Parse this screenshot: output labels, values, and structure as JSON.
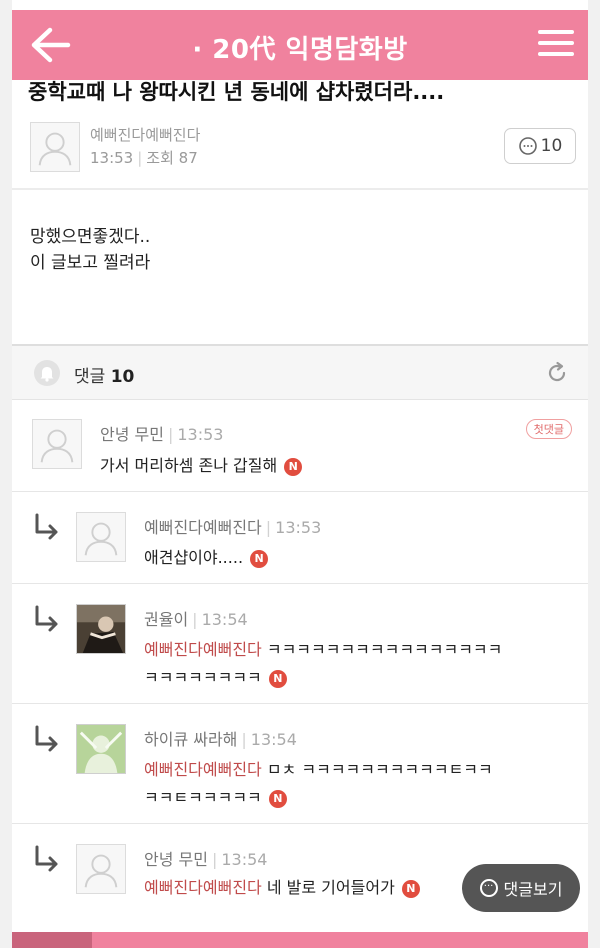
{
  "header": {
    "title": "· 20代 익명담화방"
  },
  "post": {
    "title": "중학교때 나 왕따시킨 년 동네에 샵차렸더라....",
    "author": "예뻐진다예뻐진다",
    "time": "13:53",
    "views": "조회 87",
    "comment_count": "10",
    "body_lines": [
      "망했으면좋겠다..",
      "이 글보고 찔려라"
    ]
  },
  "comments_bar": {
    "label": "댓글",
    "count": "10"
  },
  "comments": [
    {
      "name": "안녕 무민",
      "time": "13:53",
      "badge": "첫댓글",
      "text": "가서 머리하셈 존나 갑질해"
    },
    {
      "name": "예뻐진다예뻐진다",
      "time": "13:53",
      "text": "애견샵이야....."
    },
    {
      "name": "권율이",
      "time": "13:54",
      "mention": "예뻐진다예뻐진다",
      "text_line1": " ㅋㅋㅋㅋㅋㅋㅋㅋㅋㅋㅋㅋㅋㅋㅋㅋ",
      "text_line2": "ㅋㅋㅋㅋㅋㅋㅋㅋ"
    },
    {
      "name": "하이큐 싸라해",
      "time": "13:54",
      "mention": "예뻐진다예뻐진다",
      "text_line1": " ㅁㅊ ㅋㅋㅋㅋㅋㅋㅋㅋㅋㅋㅌㅋㅋ",
      "text_line2": "ㅋㅋㅌㅋㅋㅋㅋㅋ"
    },
    {
      "name": "안녕 무민",
      "time": "13:54",
      "mention": "예뻐진다예뻐진다",
      "text": " 네 발로 기어들어가"
    }
  ],
  "n_badge": "N",
  "view_comments_button": "댓글보기",
  "colors": {
    "brand_pink": "#f0829e",
    "mention": "#c04b4b",
    "n_badge": "#e14d3f"
  },
  "icons": [
    "back-arrow-icon",
    "hamburger-menu-icon",
    "comment-bubble-icon",
    "bell-icon",
    "refresh-icon",
    "reply-arrow-icon",
    "default-avatar-icon"
  ]
}
